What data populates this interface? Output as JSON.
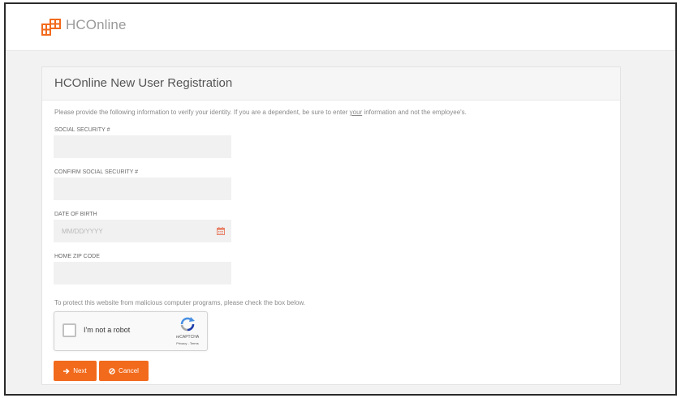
{
  "header": {
    "brand_name": "HCOnline",
    "logo_icon": "hconline-grid-logo-icon",
    "brand_color": "#f26a1b"
  },
  "registration": {
    "title": "HCOnline New User Registration",
    "instructions_pre": "Please provide the following information to verify your identity. If you are a dependent, be sure to enter ",
    "instructions_emphasis": "your",
    "instructions_post": " information and not the employee's.",
    "fields": {
      "ssn": {
        "label": "SOCIAL SECURITY #",
        "value": "",
        "placeholder": ""
      },
      "confirm_ssn": {
        "label": "CONFIRM SOCIAL SECURITY #",
        "value": "",
        "placeholder": ""
      },
      "dob": {
        "label": "DATE OF BIRTH",
        "value": "",
        "placeholder": "MM/DD/YYYY",
        "icon": "calendar-icon"
      },
      "zip": {
        "label": "HOME ZIP CODE",
        "value": "",
        "placeholder": ""
      }
    },
    "captcha_note": "To protect this website from malicious computer programs, please check the box below.",
    "captcha": {
      "label": "I'm not a robot",
      "brand": "reCAPTCHA",
      "links": "Privacy - Terms",
      "checked": false
    },
    "buttons": {
      "next_label": "Next",
      "next_icon": "arrow-right-icon",
      "cancel_label": "Cancel",
      "cancel_icon": "ban-icon",
      "accent_color": "#f26a1b"
    }
  }
}
